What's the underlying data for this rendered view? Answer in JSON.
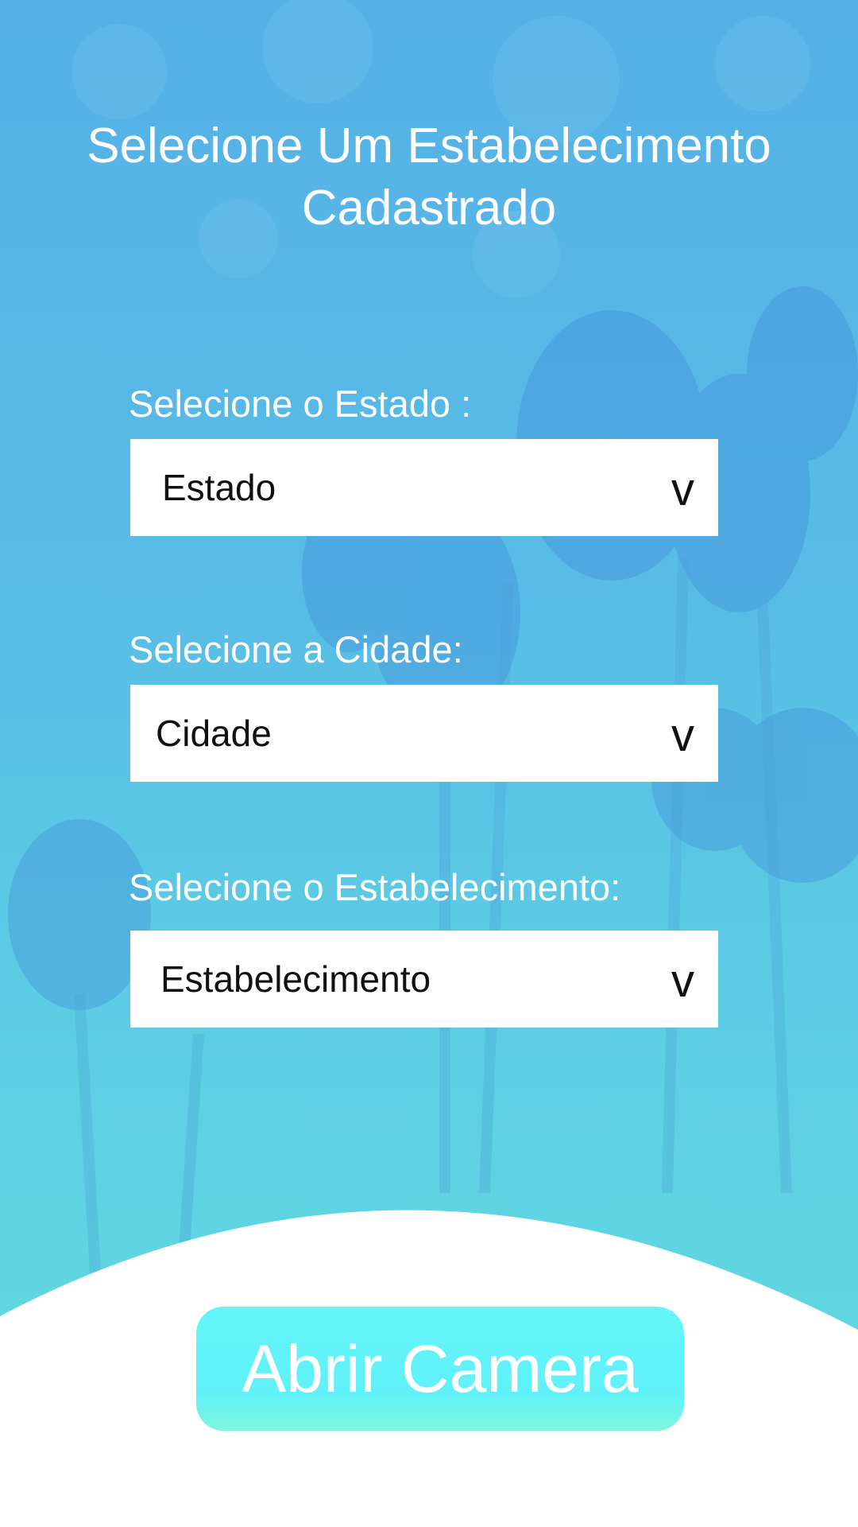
{
  "header": {
    "title_line1": "Selecione Um Estabelecimento",
    "title_line2": "Cadastrado"
  },
  "form": {
    "estado": {
      "label": "Selecione o Estado :",
      "value": "Estado",
      "caret": "v"
    },
    "cidade": {
      "label": "Selecione a Cidade:",
      "value": "Cidade",
      "caret": "v"
    },
    "estabelecimento": {
      "label": "Selecione o Estabelecimento:",
      "value": "Estabelecimento",
      "caret": "v"
    }
  },
  "actions": {
    "camera_label": "Abrir Camera"
  },
  "colors": {
    "background_top": "#56b0e6",
    "background_bottom": "#62dcdf",
    "button": "#63f5f9",
    "text_light": "#ffffff"
  }
}
